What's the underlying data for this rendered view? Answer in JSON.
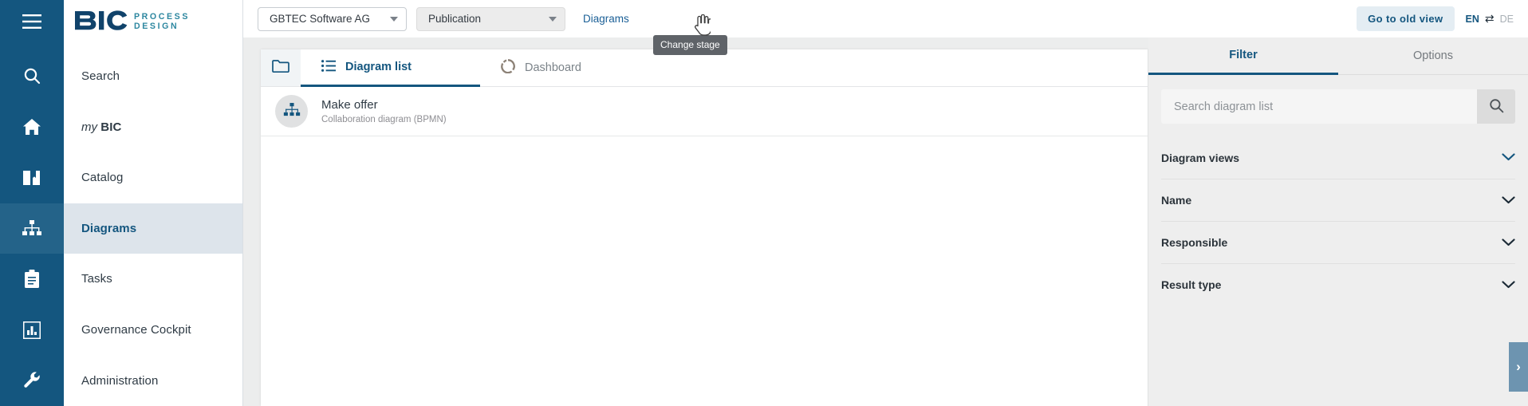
{
  "brand": {
    "name_bic": "BIC",
    "name_line1": "PROCESS",
    "name_line2": "DESIGN"
  },
  "rail": {
    "items": [
      {
        "icon": "hamburger-menu-icon",
        "name": "menu"
      },
      {
        "icon": "search-icon",
        "name": "search"
      },
      {
        "icon": "home-icon",
        "name": "mybic"
      },
      {
        "icon": "book-icon",
        "name": "catalog"
      },
      {
        "icon": "hierarchy-icon",
        "name": "diagrams"
      },
      {
        "icon": "clipboard-icon",
        "name": "tasks"
      },
      {
        "icon": "bar-chart-icon",
        "name": "governance"
      },
      {
        "icon": "wrench-icon",
        "name": "administration"
      }
    ]
  },
  "sidebar": {
    "items": [
      {
        "label": "Search",
        "active": false
      },
      {
        "label": "myBIC",
        "active": false,
        "italic_prefix": "my",
        "bold_suffix": "BIC"
      },
      {
        "label": "Catalog",
        "active": false
      },
      {
        "label": "Diagrams",
        "active": true
      },
      {
        "label": "Tasks",
        "active": false
      },
      {
        "label": "Governance Cockpit",
        "active": false
      },
      {
        "label": "Administration",
        "active": false
      }
    ]
  },
  "header": {
    "org_select": {
      "value": "GBTEC Software AG"
    },
    "stage_select": {
      "value": "Publication"
    },
    "breadcrumb": "Diagrams",
    "old_view_button": "Go to old view",
    "lang_active": "EN",
    "lang_inactive": "DE",
    "swap_icon": "⇄",
    "tooltip": "Change stage"
  },
  "main": {
    "tabs": [
      {
        "label": "Diagram list",
        "icon": "list-icon",
        "active": true
      },
      {
        "label": "Dashboard",
        "icon": "donut-chart-icon",
        "active": false
      }
    ],
    "folder_icon": "folder-icon",
    "rows": [
      {
        "title": "Make offer",
        "subtitle": "Collaboration diagram (BPMN)",
        "icon": "org-chart-icon"
      }
    ]
  },
  "filter": {
    "tabs": [
      {
        "label": "Filter",
        "active": true
      },
      {
        "label": "Options",
        "active": false
      }
    ],
    "search": {
      "value": "",
      "placeholder": "Search diagram list",
      "icon": "search-icon"
    },
    "sections": [
      {
        "label": "Diagram views",
        "expanded": false,
        "accent": true
      },
      {
        "label": "Name",
        "expanded": false,
        "accent": false
      },
      {
        "label": "Responsible",
        "expanded": false,
        "accent": false
      },
      {
        "label": "Result type",
        "expanded": false,
        "accent": false
      }
    ],
    "collapse_tab": "›"
  },
  "colors": {
    "rail_bg": "#14567f",
    "rail_active": "#246389",
    "nav_active_bg": "#dde4eb",
    "accent": "#14567f",
    "breadcrumb": "#1a5f96",
    "panel_bg": "#eceded",
    "filter_bg": "#eeeeee",
    "collapse_tab": "#6d94b0",
    "tooltip_bg": "#5f6368"
  }
}
